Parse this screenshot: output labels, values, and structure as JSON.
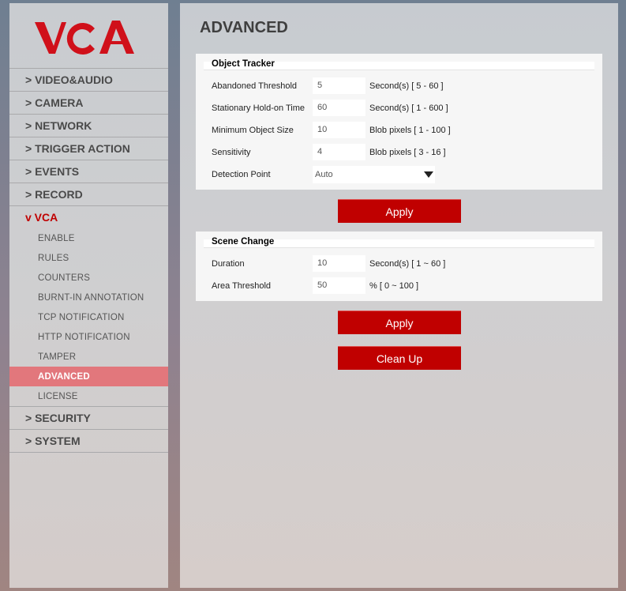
{
  "logo": {
    "text": "VCA"
  },
  "nav": {
    "video_audio": "> VIDEO&AUDIO",
    "camera": "> CAMERA",
    "network": "> NETWORK",
    "trigger_action": "> TRIGGER ACTION",
    "events": "> EVENTS",
    "record": "> RECORD",
    "vca": "v VCA",
    "vca_items": [
      "ENABLE",
      "RULES",
      "COUNTERS",
      "BURNT-IN ANNOTATION",
      "TCP NOTIFICATION",
      "HTTP NOTIFICATION",
      "TAMPER",
      "ADVANCED",
      "LICENSE"
    ],
    "security": "> SECURITY",
    "system": "> SYSTEM"
  },
  "page": {
    "title": "ADVANCED"
  },
  "object_tracker": {
    "title": "Object Tracker",
    "abandoned_label": "Abandoned Threshold",
    "abandoned_value": "5",
    "abandoned_range": "Second(s) [ 5 - 60 ]",
    "stationary_label": "Stationary Hold-on Time",
    "stationary_value": "60",
    "stationary_range": "Second(s) [ 1 - 600 ]",
    "min_size_label": "Minimum Object Size",
    "min_size_value": "10",
    "min_size_range": "Blob pixels [ 1 - 100 ]",
    "sensitivity_label": "Sensitivity",
    "sensitivity_value": "4",
    "sensitivity_range": "Blob pixels [ 3 - 16 ]",
    "detection_label": "Detection Point",
    "detection_value": "Auto",
    "apply_label": "Apply"
  },
  "scene_change": {
    "title": "Scene Change",
    "duration_label": "Duration",
    "duration_value": "10",
    "duration_range": "Second(s) [ 1 ~ 60 ]",
    "area_label": "Area Threshold",
    "area_value": "50",
    "area_range": "% [ 0 ~ 100 ]",
    "apply_label": "Apply",
    "cleanup_label": "Clean Up"
  },
  "colors": {
    "accent": "#c00000",
    "active_bg": "#e2777c"
  }
}
